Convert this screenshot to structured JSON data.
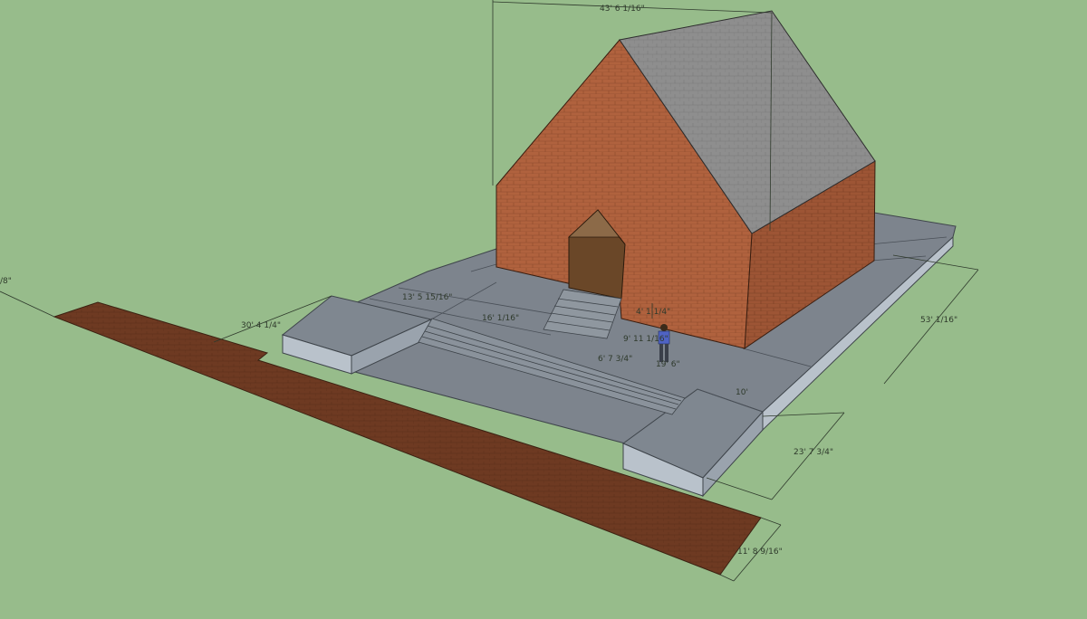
{
  "colors": {
    "ground": "#97bc8b",
    "brick": "#b0623e",
    "brick_dark": "#9a5233",
    "roof": "#8f8f8f",
    "pavement_top": "#7d848d",
    "pavement_side": "#b9c2cb",
    "walkway": "#6f3a21",
    "dimension": "#2f3a2c"
  },
  "dimensions": {
    "ridge_length": "43' 6 1/16\"",
    "partial_left": "/8\"",
    "walkway_offset": "30' 4 1/4\"",
    "upper_terrace": "13' 5 15/16\"",
    "stair_run": "16' 1/16\"",
    "step_height": "4' 1 1/4\"",
    "landing_width": "9' 11 1/16\"",
    "lower_step": "6' 7 3/4\"",
    "landing_depth": "19' 6\"",
    "side_width": "10'",
    "plaza_width": "53' 1/16\"",
    "plaza_depth": "23' 7 3/4\"",
    "walkway_width": "11' 8 9/16\""
  }
}
